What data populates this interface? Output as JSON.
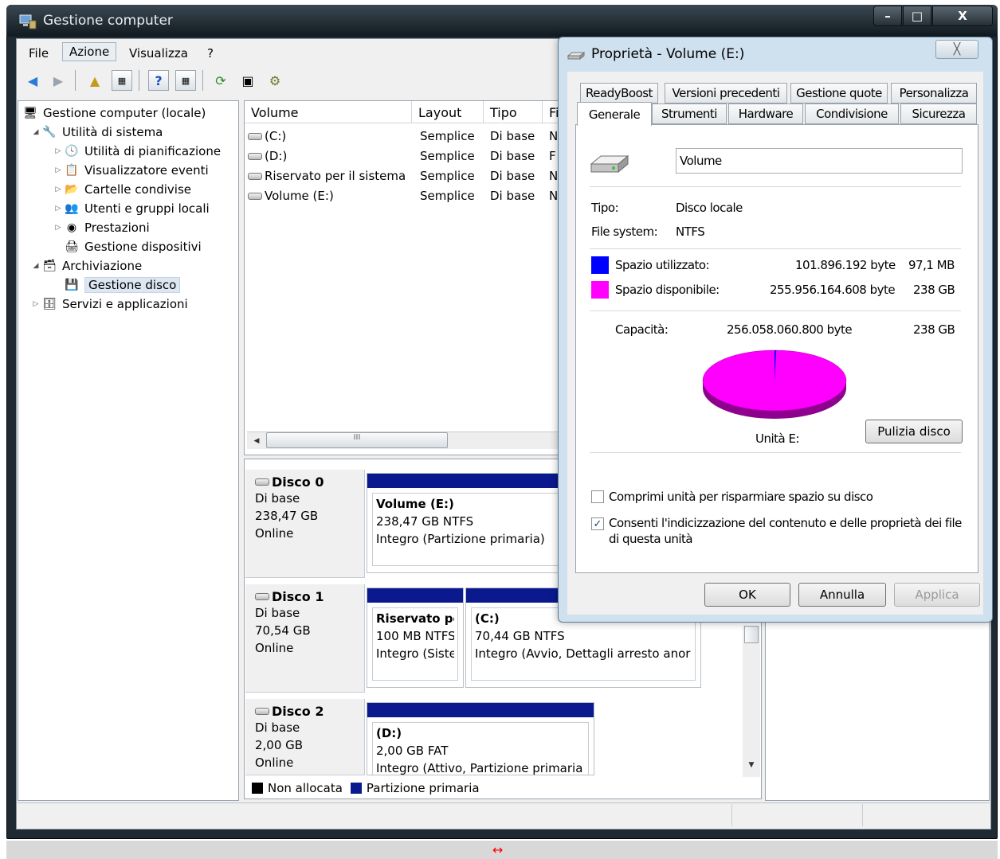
{
  "window": {
    "title": "Gestione computer",
    "min": "–",
    "max": "□",
    "close": "X"
  },
  "menu": [
    "File",
    "Azione",
    "Visualizza",
    "?"
  ],
  "tree": {
    "root": "Gestione computer (locale)",
    "sys": "Utilità di sistema",
    "sched": "Utilità di pianificazione",
    "events": "Visualizzatore eventi",
    "shares": "Cartelle condivise",
    "users": "Utenti e gruppi locali",
    "perf": "Prestazioni",
    "devices": "Gestione dispositivi",
    "storage": "Archiviazione",
    "diskmgmt": "Gestione disco",
    "services": "Servizi e applicazioni"
  },
  "volumes": {
    "headers": [
      "Volume",
      "Layout",
      "Tipo",
      "Fi"
    ],
    "rows": [
      {
        "name": "(C:)",
        "layout": "Semplice",
        "type": "Di base",
        "fs": "N"
      },
      {
        "name": "(D:)",
        "layout": "Semplice",
        "type": "Di base",
        "fs": "F"
      },
      {
        "name": "Riservato per il sistema",
        "layout": "Semplice",
        "type": "Di base",
        "fs": "N"
      },
      {
        "name": "Volume (E:)",
        "layout": "Semplice",
        "type": "Di base",
        "fs": "N"
      }
    ],
    "scroll_thumb": "III"
  },
  "disks": [
    {
      "title": "Disco 0",
      "type": "Di base",
      "size": "238,47 GB",
      "status": "Online",
      "parts": [
        {
          "name": "Volume  (E:)",
          "size": "238,47 GB NTFS",
          "state": "Integro (Partizione primaria)"
        }
      ]
    },
    {
      "title": "Disco 1",
      "type": "Di base",
      "size": "70,54 GB",
      "status": "Online",
      "parts": [
        {
          "name": "Riservato pe",
          "size": "100 MB NTFS",
          "state": "Integro (Siste"
        },
        {
          "name": "(C:)",
          "size": "70,44 GB NTFS",
          "state": "Integro (Avvio, Dettagli arresto anor"
        }
      ]
    },
    {
      "title": "Disco 2",
      "type": "Di base",
      "size": "2,00 GB",
      "status": "Online",
      "parts": [
        {
          "name": "(D:)",
          "size": "2,00 GB FAT",
          "state": "Integro (Attivo, Partizione primaria"
        }
      ]
    }
  ],
  "legend": {
    "unalloc": "Non allocata",
    "primary": "Partizione primaria"
  },
  "dialog": {
    "title": "Proprietà - Volume (E:)",
    "close": "╳",
    "tabs_row1": [
      "ReadyBoost",
      "Versioni precedenti",
      "Gestione quote",
      "Personalizza"
    ],
    "tabs_row2": [
      "Generale",
      "Strumenti",
      "Hardware",
      "Condivisione",
      "Sicurezza"
    ],
    "label_value": "Volume",
    "type_label": "Tipo:",
    "type_value": "Disco locale",
    "fs_label": "File system:",
    "fs_value": "NTFS",
    "used_label": "Spazio utilizzato:",
    "used_bytes": "101.896.192 byte",
    "used_short": "97,1 MB",
    "free_label": "Spazio disponibile:",
    "free_bytes": "255.956.164.608 byte",
    "free_short": "238 GB",
    "cap_label": "Capacità:",
    "cap_bytes": "256.058.060.800 byte",
    "cap_short": "238 GB",
    "drive_label": "Unità E:",
    "cleanup": "Pulizia disco",
    "compress": "Comprimi unità per risparmiare spazio su disco",
    "index": "Consenti l'indicizzazione del contenuto e delle proprietà dei file",
    "index2": "di questa unità",
    "index_check": "✓",
    "ok": "OK",
    "cancel": "Annulla",
    "apply": "Applica",
    "used_fraction": 0.0004
  },
  "colors": {
    "used": "#0000ff",
    "free": "#ff00ff",
    "partition": "#0a1a8e"
  },
  "resize_glyph": "↔"
}
